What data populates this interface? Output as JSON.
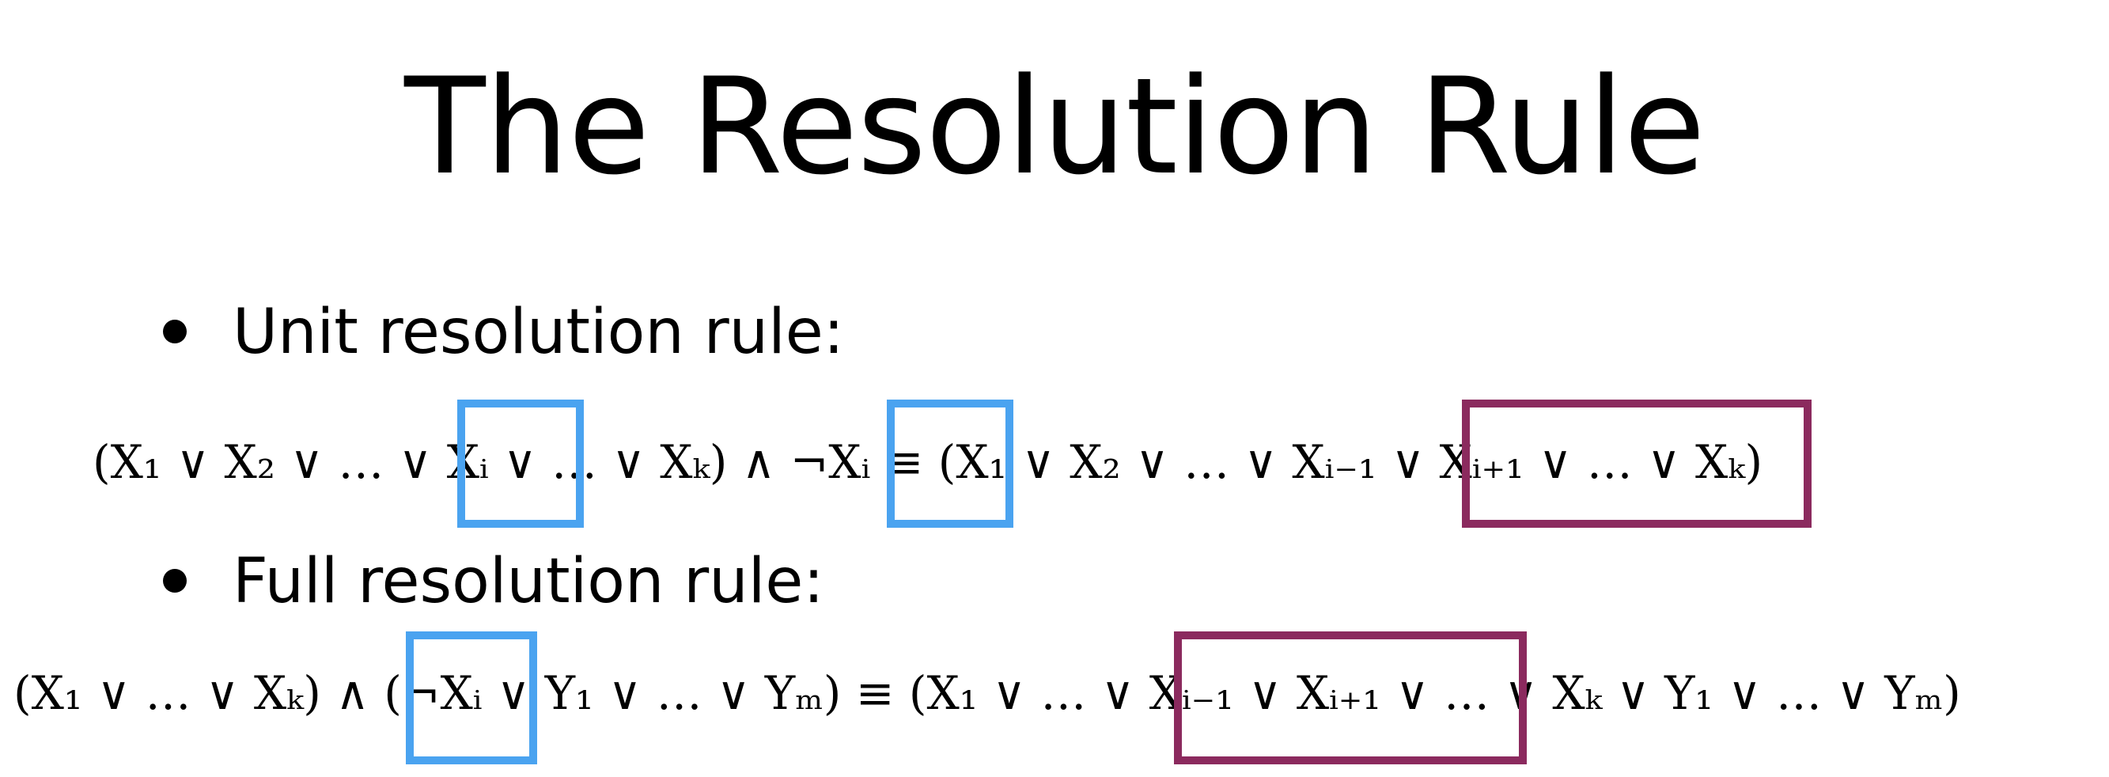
{
  "slide": {
    "title": "The Resolution Rule",
    "bullets": [
      {
        "label": "Unit resolution rule:"
      },
      {
        "label": "Full resolution rule:"
      }
    ]
  },
  "formulas": {
    "unit": "(X₁ ∨ X₂ ∨ … ∨ Xᵢ ∨ … ∨ Xₖ) ∧ ¬Xᵢ ≡ (X₁ ∨ X₂ ∨ … ∨ Xᵢ₋₁ ∨ Xᵢ₊₁ ∨ … ∨ Xₖ)",
    "full": "(X₁ ∨ … ∨ Xₖ) ∧ (¬Xᵢ ∨ Y₁ ∨ … ∨ Yₘ) ≡ (X₁ ∨ … ∨ Xᵢ₋₁ ∨ Xᵢ₊₁ ∨ … ∨ Xₖ ∨ Y₁ ∨ … ∨ Yₘ)"
  },
  "colors": {
    "highlight_literal": "#4aa3f0",
    "highlight_result": "#8b2a5e"
  }
}
